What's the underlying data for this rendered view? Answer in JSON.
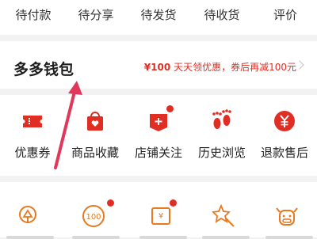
{
  "orders": {
    "pending_payment": "待付款",
    "pending_share": "待分享",
    "pending_ship": "待发货",
    "pending_receive": "待收货",
    "review": "评价"
  },
  "wallet": {
    "title": "多多钱包",
    "promo_amount": "¥100",
    "promo_text": "天天领优惠，券后再减100元"
  },
  "services": [
    {
      "label": "优惠券",
      "icon": "coupon-icon"
    },
    {
      "label": "商品收藏",
      "icon": "favorites-bag-icon"
    },
    {
      "label": "店铺关注",
      "icon": "store-follow-icon"
    },
    {
      "label": "历史浏览",
      "icon": "footprints-icon"
    },
    {
      "label": "退款售后",
      "icon": "refund-yen-icon"
    }
  ],
  "tools_icons": [
    "tree-icon",
    "coin-100-icon",
    "yen-card-icon",
    "star-wand-icon",
    "cow-icon"
  ],
  "colors": {
    "accent": "#e02e24",
    "background": "#f2f2f2",
    "arrow": "#e0375a"
  }
}
